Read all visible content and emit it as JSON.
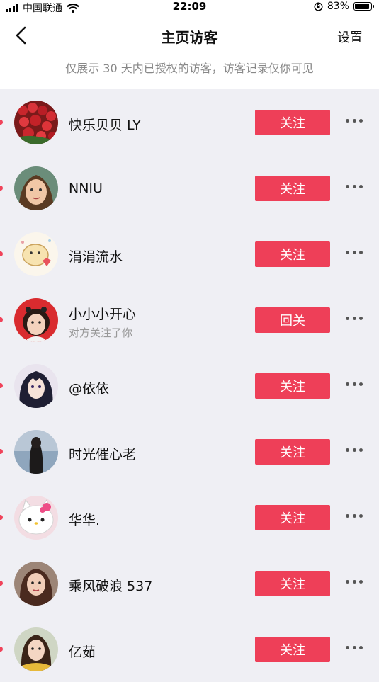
{
  "status_bar": {
    "carrier": "中国联通",
    "time": "22:09",
    "battery": "83%",
    "battery_level": 0.83
  },
  "header": {
    "title": "主页访客",
    "settings_label": "设置"
  },
  "notice": "仅展示 30 天内已授权的访客，访客记录仅你可见",
  "visitors": [
    {
      "name": "快乐贝贝 LY",
      "subtitle": "",
      "button": "关注",
      "avatar_icon": "red-roses-avatar"
    },
    {
      "name": "NNIU",
      "subtitle": "",
      "button": "关注",
      "avatar_icon": "child-portrait-avatar"
    },
    {
      "name": "涓涓流水",
      "subtitle": "",
      "button": "关注",
      "avatar_icon": "cartoon-sticker-avatar"
    },
    {
      "name": "小小小开心",
      "subtitle": "对方关注了你",
      "button": "回关",
      "avatar_icon": "girl-portrait-avatar"
    },
    {
      "name": "@依依",
      "subtitle": "",
      "button": "关注",
      "avatar_icon": "anime-girl-avatar"
    },
    {
      "name": "时光催心老",
      "subtitle": "",
      "button": "关注",
      "avatar_icon": "woman-back-avatar"
    },
    {
      "name": "华华.",
      "subtitle": "",
      "button": "关注",
      "avatar_icon": "hello-kitty-avatar"
    },
    {
      "name": "乘风破浪 537",
      "subtitle": "",
      "button": "关注",
      "avatar_icon": "woman-portrait-avatar"
    },
    {
      "name": "亿茹",
      "subtitle": "",
      "button": "关注",
      "avatar_icon": "kid-portrait-avatar"
    }
  ],
  "colors": {
    "accent": "#ee3f58",
    "unread_dot": "#f0435a"
  }
}
